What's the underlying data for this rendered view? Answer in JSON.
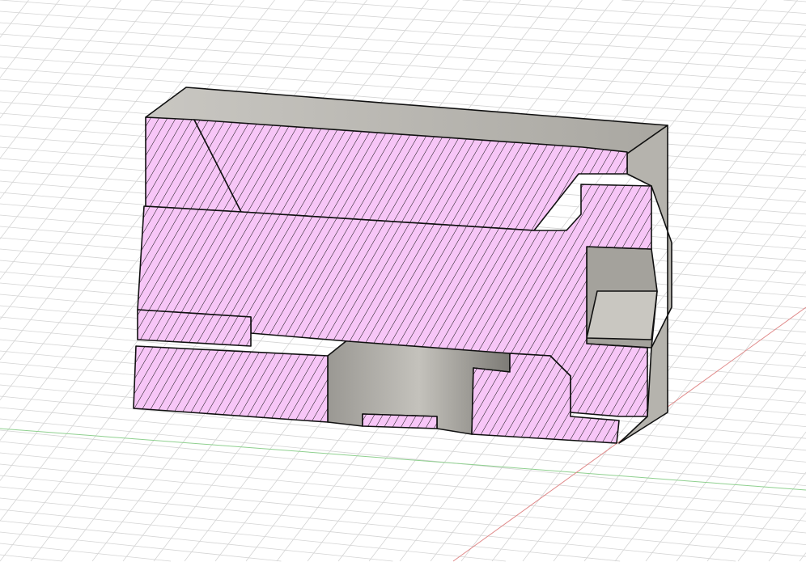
{
  "viewport": {
    "background": "#ffffff",
    "grid_color": "#d4d4d4",
    "x_axis_color": "#e08a8a",
    "y_axis_color": "#8fd08f",
    "section_fill": "#f7c6f7",
    "hatch_color": "#111111",
    "body_face": "#b8b6b0",
    "body_dark": "#8f8d87"
  }
}
